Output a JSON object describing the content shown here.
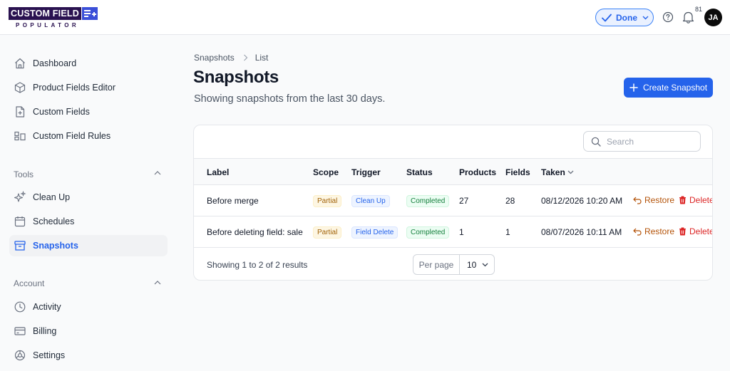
{
  "app": {
    "logo_main": "CUSTOM FIELD",
    "logo_sub": "POPULATOR",
    "status_button": "Done",
    "notification_count": "81",
    "user_initials": "JA"
  },
  "sidebar": {
    "items": [
      {
        "label": "Dashboard",
        "icon": "home-icon"
      },
      {
        "label": "Product Fields Editor",
        "icon": "cube-icon"
      },
      {
        "label": "Custom Fields",
        "icon": "document-plus-icon"
      },
      {
        "label": "Custom Field Rules",
        "icon": "rules-icon"
      }
    ],
    "tools_label": "Tools",
    "tools_items": [
      {
        "label": "Clean Up",
        "icon": "sparkles-icon"
      },
      {
        "label": "Schedules",
        "icon": "calendar-icon"
      },
      {
        "label": "Snapshots",
        "icon": "archive-icon",
        "active": true
      }
    ],
    "account_label": "Account",
    "account_items": [
      {
        "label": "Activity",
        "icon": "clock-icon"
      },
      {
        "label": "Billing",
        "icon": "credit-card-icon"
      },
      {
        "label": "Settings",
        "icon": "gear-icon"
      }
    ]
  },
  "breadcrumb": [
    "Snapshots",
    "List"
  ],
  "page": {
    "title": "Snapshots",
    "subtitle": "Showing snapshots from the last 30 days.",
    "create_button": "Create Snapshot"
  },
  "table": {
    "search_placeholder": "Search",
    "columns": [
      "Label",
      "Scope",
      "Trigger",
      "Status",
      "Products",
      "Fields",
      "Taken"
    ],
    "rows": [
      {
        "label": "Before merge",
        "scope": "Partial",
        "trigger": "Clean Up",
        "status": "Completed",
        "products": "27",
        "fields": "28",
        "taken": "08/12/2026 10:20 AM"
      },
      {
        "label": "Before deleting field: sale",
        "scope": "Partial",
        "trigger": "Field Delete",
        "status": "Completed",
        "products": "1",
        "fields": "1",
        "taken": "08/07/2026 10:11 AM"
      }
    ],
    "restore_label": "Restore",
    "delete_label": "Delete",
    "footer": "Showing 1 to 2 of 2 results",
    "per_page_label": "Per page",
    "per_page_value": "10"
  },
  "colors": {
    "primary": "#2563eb",
    "logo_bg": "#2a1250",
    "restore": "#b45309",
    "delete": "#dc2626"
  }
}
